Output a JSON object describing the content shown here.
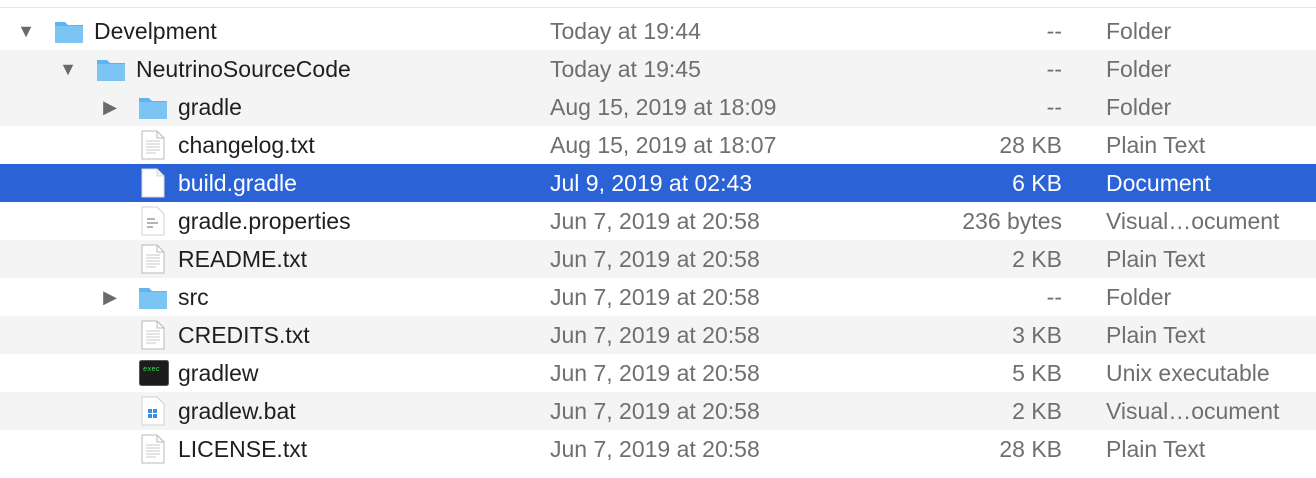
{
  "rows": [
    {
      "name": "Develpment",
      "date": "Today at 19:44",
      "size": "--",
      "kind": "Folder",
      "icon": "folder",
      "disclosure": "open",
      "level": 0
    },
    {
      "name": "NeutrinoSourceCode",
      "date": "Today at 19:45",
      "size": "--",
      "kind": "Folder",
      "icon": "folder",
      "disclosure": "open",
      "level": 1
    },
    {
      "name": "gradle",
      "date": "Aug 15, 2019 at 18:09",
      "size": "--",
      "kind": "Folder",
      "icon": "folder",
      "disclosure": "closed",
      "level": 2
    },
    {
      "name": "changelog.txt",
      "date": "Aug 15, 2019 at 18:07",
      "size": "28 KB",
      "kind": "Plain Text",
      "icon": "text-doc",
      "disclosure": "none",
      "level": 2
    },
    {
      "name": "build.gradle",
      "date": "Jul 9, 2019 at 02:43",
      "size": "6 KB",
      "kind": "Document",
      "icon": "blank-doc",
      "disclosure": "none",
      "level": 2,
      "selected": true
    },
    {
      "name": "gradle.properties",
      "date": "Jun 7, 2019 at 20:58",
      "size": "236 bytes",
      "kind": "Visual…ocument",
      "icon": "code-doc",
      "disclosure": "none",
      "level": 2
    },
    {
      "name": "README.txt",
      "date": "Jun 7, 2019 at 20:58",
      "size": "2 KB",
      "kind": "Plain Text",
      "icon": "text-doc",
      "disclosure": "none",
      "level": 2
    },
    {
      "name": "src",
      "date": "Jun 7, 2019 at 20:58",
      "size": "--",
      "kind": "Folder",
      "icon": "folder",
      "disclosure": "closed",
      "level": 2
    },
    {
      "name": "CREDITS.txt",
      "date": "Jun 7, 2019 at 20:58",
      "size": "3 KB",
      "kind": "Plain Text",
      "icon": "text-doc",
      "disclosure": "none",
      "level": 2
    },
    {
      "name": "gradlew",
      "date": "Jun 7, 2019 at 20:58",
      "size": "5 KB",
      "kind": "Unix executable",
      "icon": "terminal",
      "disclosure": "none",
      "level": 2
    },
    {
      "name": "gradlew.bat",
      "date": "Jun 7, 2019 at 20:58",
      "size": "2 KB",
      "kind": "Visual…ocument",
      "icon": "windows-doc",
      "disclosure": "none",
      "level": 2
    },
    {
      "name": "LICENSE.txt",
      "date": "Jun 7, 2019 at 20:58",
      "size": "28 KB",
      "kind": "Plain Text",
      "icon": "text-doc",
      "disclosure": "none",
      "level": 2
    }
  ],
  "colors": {
    "selection": "#2b63d6",
    "folder": "#5db4f0",
    "stripe": "#f4f4f5"
  }
}
